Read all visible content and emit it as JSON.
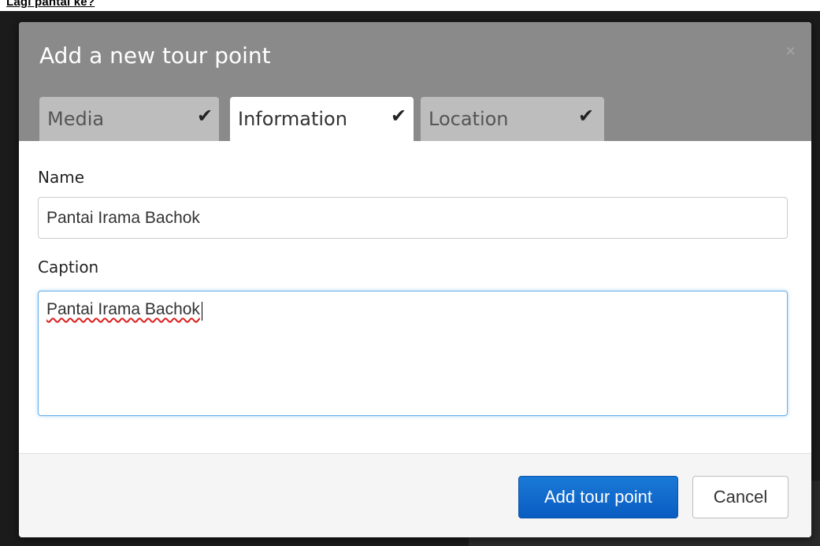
{
  "page": {
    "top_link": "Lagi pantai ke?"
  },
  "modal": {
    "title": "Add a new tour point",
    "close_symbol": "×",
    "tabs": [
      {
        "label": "Media",
        "checked": true,
        "active": false
      },
      {
        "label": "Information",
        "checked": true,
        "active": true
      },
      {
        "label": "Location",
        "checked": true,
        "active": false
      }
    ],
    "check_symbol": "✔",
    "fields": {
      "name_label": "Name",
      "name_value": "Pantai Irama Bachok",
      "caption_label": "Caption",
      "caption_value": "Pantai Irama Bachok"
    },
    "buttons": {
      "add_label": "Add tour point",
      "cancel_label": "Cancel"
    }
  },
  "colors": {
    "header_bg": "#8a8a8a",
    "tab_inactive_bg": "#bdbdbd",
    "primary_button": "#0a63c9",
    "focus_border": "#66afe9"
  }
}
